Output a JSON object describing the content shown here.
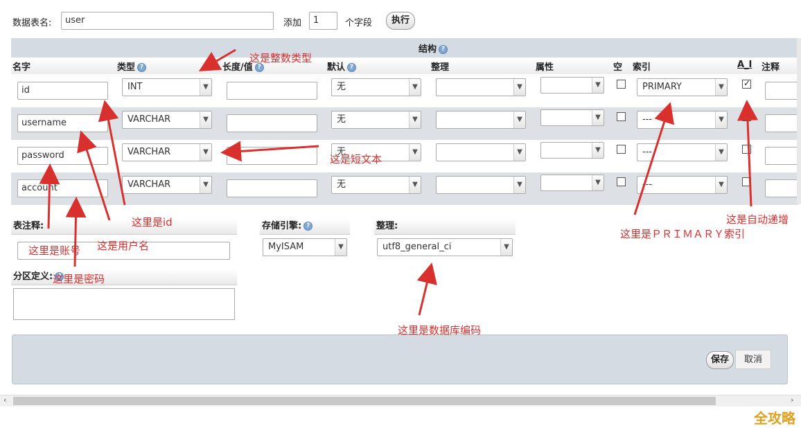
{
  "table_name": {
    "label": "数据表名:",
    "value": "user"
  },
  "add_fields": {
    "label": "添加",
    "count": "1",
    "suffix": "个字段",
    "button": "执行"
  },
  "structure": {
    "title": "结构"
  },
  "columns": {
    "name": "名字",
    "type": "类型",
    "length": "长度/值",
    "default": "默认",
    "collation": "整理",
    "attributes": "属性",
    "null": "空",
    "index": "索引",
    "ai": "A_I",
    "comment": "注释"
  },
  "rows": [
    {
      "name": "id",
      "type": "INT",
      "default": "无",
      "index": "PRIMARY",
      "null": false,
      "ai": true
    },
    {
      "name": "username",
      "type": "VARCHAR",
      "default": "无",
      "index": "---",
      "null": false,
      "ai": false
    },
    {
      "name": "password",
      "type": "VARCHAR",
      "default": "无",
      "index": "---",
      "null": false,
      "ai": false
    },
    {
      "name": "account",
      "type": "VARCHAR",
      "default": "无",
      "index": "---",
      "null": false,
      "ai": false
    }
  ],
  "table_comment": {
    "label": "表注释:"
  },
  "storage_engine": {
    "label": "存储引擎:",
    "value": "MyISAM"
  },
  "collation_section": {
    "label": "整理:",
    "value": "utf8_general_ci"
  },
  "partition": {
    "label": "分区定义:"
  },
  "actions": {
    "save": "保存",
    "cancel": "取消"
  },
  "annotations": {
    "int_type": "这是整数类型",
    "short_text": "这是短文本",
    "id": "这里是id",
    "username": "这是用户名",
    "account": "这里是账号",
    "password": "这里是密码",
    "primary": "这里是ＰＲＩＭＡＲＹ索引",
    "auto_inc": "这是自动递增",
    "db_encoding": "这里是数据库编码"
  },
  "watermark": "全攻略",
  "colors": {
    "row_alt": "#dde1e6",
    "header_bar": "#d4dbe3",
    "annotation": "#d8302d"
  }
}
